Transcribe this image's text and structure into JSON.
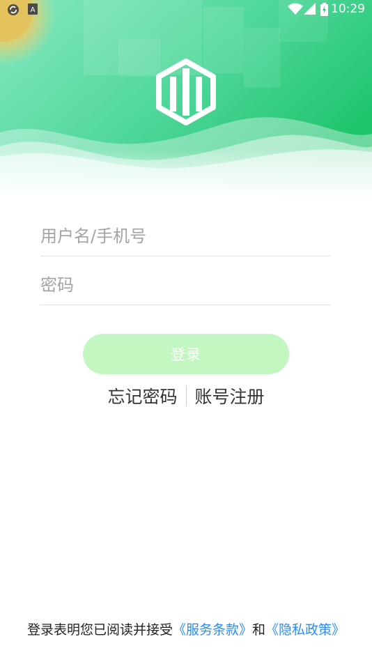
{
  "status_bar": {
    "time": "10:29",
    "left_icons": [
      "sync-icon",
      "app-notification-icon"
    ],
    "right_icons": [
      "wifi-icon",
      "signal-icon",
      "battery-icon"
    ]
  },
  "header": {
    "logo_icon": "building-logo-icon",
    "colors": {
      "gradient_start": "#86e8c2",
      "gradient_end": "#1ec46c",
      "accent": "#2ac977"
    }
  },
  "form": {
    "username": {
      "placeholder": "用户名/手机号",
      "value": ""
    },
    "password": {
      "placeholder": "密码",
      "value": ""
    },
    "login_label": "登录",
    "login_color": "#c3f7c1"
  },
  "links": {
    "forgot_password": "忘记密码",
    "register": "账号注册"
  },
  "agreement": {
    "prefix": "登录表明您已阅读并接受",
    "terms": "《服务条款》",
    "conjunction": "和",
    "privacy": "《隐私政策》",
    "link_color": "#2c8df0"
  }
}
